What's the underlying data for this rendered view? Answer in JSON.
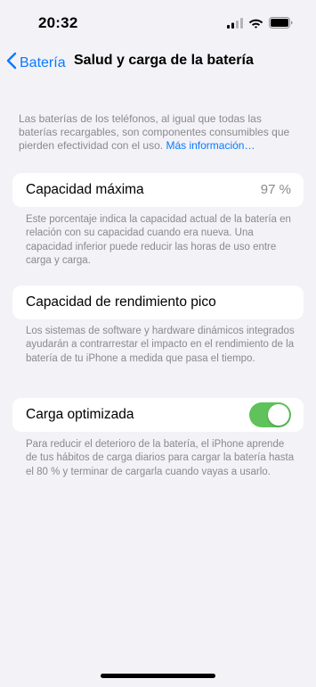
{
  "status_bar": {
    "time": "20:32",
    "icons": [
      "signal-icon",
      "wifi-icon",
      "battery-icon"
    ]
  },
  "nav": {
    "back_label": "Batería",
    "title": "Salud y carga de la batería"
  },
  "intro": {
    "text": "Las baterías de los teléfonos, al igual que todas las baterías recargables, son componentes consumibles que pierden efectividad con el uso.",
    "link": "Más información…"
  },
  "max_capacity": {
    "label": "Capacidad máxima",
    "value": "97 %",
    "note": "Este porcentaje indica la capacidad actual de la batería en relación con su capacidad cuando era nueva. Una capacidad inferior puede reducir las horas de uso entre carga y carga."
  },
  "peak_performance": {
    "label": "Capacidad de rendimiento pico",
    "note": "Los sistemas de software y hardware dinámicos integrados ayudarán a contrarrestar el impacto en el rendimiento de la batería de tu iPhone a medida que pasa el tiempo."
  },
  "optimized_charging": {
    "label": "Carga optimizada",
    "enabled": true,
    "note": "Para reducir el deterioro de la batería, el iPhone aprende de tus hábitos de carga diarios para cargar la batería hasta el 80 % y terminar de cargarla cuando vayas a usarlo."
  },
  "colors": {
    "background": "#f2f2f7",
    "accent": "#0a7aff",
    "toggle_on": "#5fc25a",
    "secondary_text": "#8a8a8e"
  }
}
